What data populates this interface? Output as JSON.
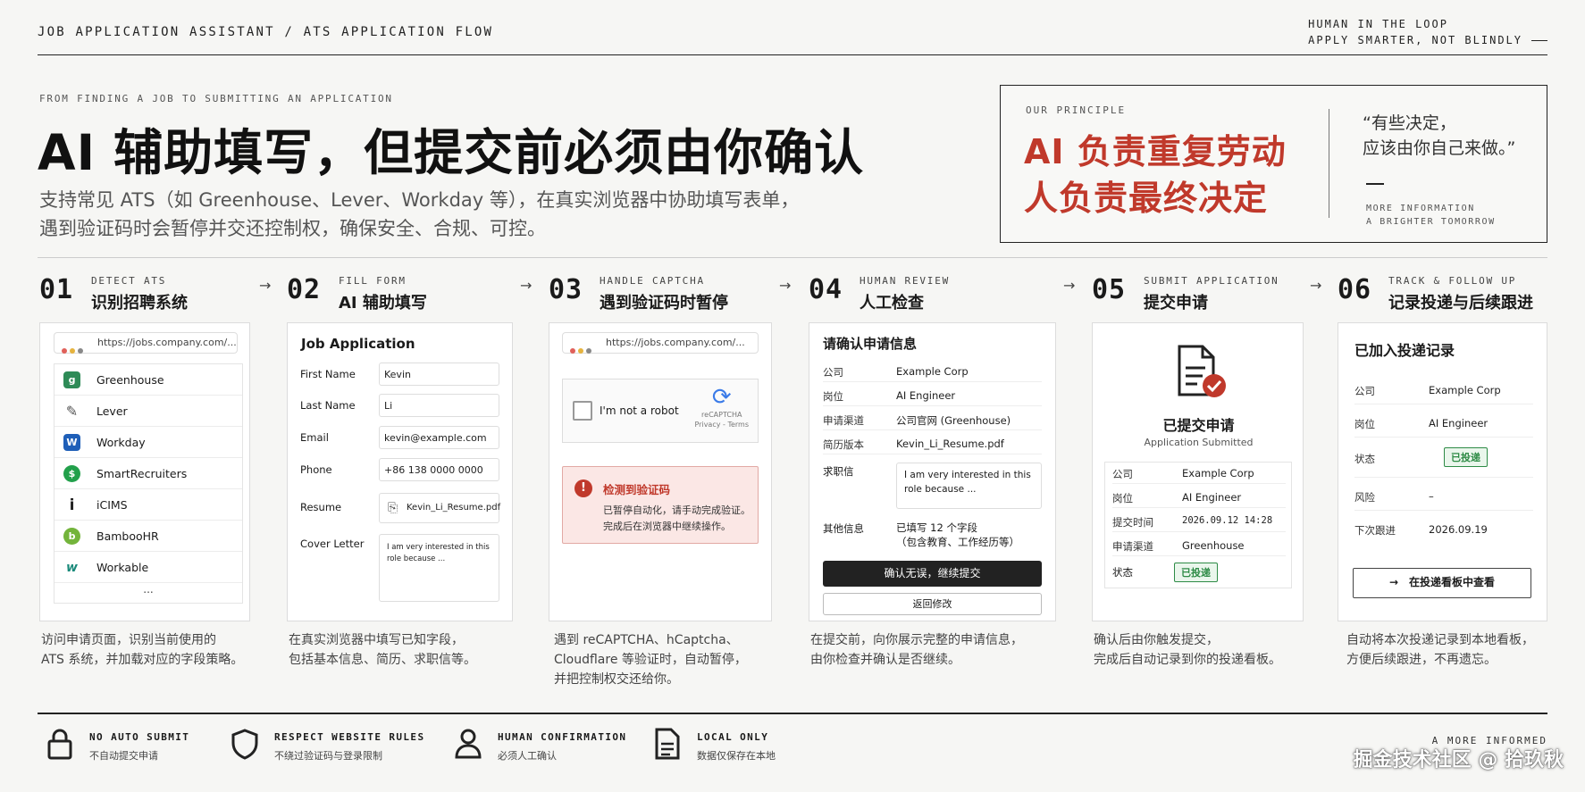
{
  "header": {
    "left": "JOB APPLICATION ASSISTANT / ATS APPLICATION FLOW",
    "right_line1": "HUMAN IN THE LOOP",
    "right_line2": "APPLY SMARTER, NOT BLINDLY"
  },
  "hero": {
    "eyebrow": "FROM FINDING A JOB TO SUBMITTING AN APPLICATION",
    "title": "AI 辅助填写，但提交前必须由你确认",
    "subtitle_line1": "支持常见 ATS（如 Greenhouse、Lever、Workday 等），在真实浏览器中协助填写表单，",
    "subtitle_line2": "遇到验证码时会暂停并交还控制权，确保安全、合规、可控。"
  },
  "principle": {
    "label": "OUR PRINCIPLE",
    "line1": "AI 负责重复劳动",
    "line2": "人负责最终决定",
    "quote_line1": "“有些决定，",
    "quote_line2": "应该由你自己来做。”",
    "more_line1": "MORE INFORMATION",
    "more_line2": "A BRIGHTER TOMORROW"
  },
  "steps": [
    {
      "num": "01",
      "en": "DETECT ATS",
      "zh": "识别招聘系统",
      "desc1": "访问申请页面，识别当前使用的",
      "desc2": "ATS 系统，并加载对应的字段策略。"
    },
    {
      "num": "02",
      "en": "FILL FORM",
      "zh": "AI 辅助填写",
      "desc1": "在真实浏览器中填写已知字段，",
      "desc2": "包括基本信息、简历、求职信等。"
    },
    {
      "num": "03",
      "en": "HANDLE CAPTCHA",
      "zh": "遇到验证码时暂停",
      "desc1": "遇到 reCAPTCHA、hCaptcha、",
      "desc2": "Cloudflare 等验证时，自动暂停，",
      "desc3": "并把控制权交还给你。"
    },
    {
      "num": "04",
      "en": "HUMAN REVIEW",
      "zh": "人工检查",
      "desc1": "在提交前，向你展示完整的申请信息，",
      "desc2": "由你检查并确认是否继续。"
    },
    {
      "num": "05",
      "en": "SUBMIT APPLICATION",
      "zh": "提交申请",
      "desc1": "确认后由你触发提交，",
      "desc2": "完成后自动记录到你的投递看板。"
    },
    {
      "num": "06",
      "en": "TRACK & FOLLOW UP",
      "zh": "记录投递与后续跟进",
      "desc1": "自动将本次投递记录到本地看板，",
      "desc2": "方便后续跟进，不再遗忘。"
    }
  ],
  "card1": {
    "url": "https://jobs.company.com/...",
    "ats": [
      {
        "name": "Greenhouse",
        "icon": "greenhouse-icon",
        "color": "#2e8b57",
        "glyph": "g"
      },
      {
        "name": "Lever",
        "icon": "lever-icon",
        "color": "#555555",
        "glyph": "/"
      },
      {
        "name": "Workday",
        "icon": "workday-icon",
        "color": "#1f5fb8",
        "glyph": "W"
      },
      {
        "name": "SmartRecruiters",
        "icon": "smartrecruiters-icon",
        "color": "#22a04b",
        "glyph": "S"
      },
      {
        "name": "iCIMS",
        "icon": "icims-icon",
        "color": "#222222",
        "glyph": "i"
      },
      {
        "name": "BambooHR",
        "icon": "bamboohr-icon",
        "color": "#73b43b",
        "glyph": "b"
      },
      {
        "name": "Workable",
        "icon": "workable-icon",
        "color": "#1a8a7a",
        "glyph": "w"
      }
    ],
    "more": "..."
  },
  "card2": {
    "title": "Job Application",
    "fields": [
      {
        "label": "First Name",
        "value": "Kevin"
      },
      {
        "label": "Last Name",
        "value": "Li"
      },
      {
        "label": "Email",
        "value": "kevin@example.com"
      },
      {
        "label": "Phone",
        "value": "+86 138 0000 0000"
      },
      {
        "label": "Resume",
        "value": "Kevin_Li_Resume.pdf"
      },
      {
        "label": "Cover Letter",
        "value": "I am very interested in this role because ..."
      }
    ]
  },
  "card3": {
    "url": "https://jobs.company.com/...",
    "captcha_text": "I'm not a robot",
    "captcha_brand": "reCAPTCHA",
    "captcha_links": "Privacy - Terms",
    "alert_title": "检测到验证码",
    "alert_line1": "已暂停自动化，请手动完成验证。",
    "alert_line2": "完成后在浏览器中继续操作。"
  },
  "card4": {
    "title": "请确认申请信息",
    "rows": [
      {
        "k": "公司",
        "v": "Example Corp"
      },
      {
        "k": "岗位",
        "v": "AI Engineer"
      },
      {
        "k": "申请渠道",
        "v": "公司官网 (Greenhouse)"
      },
      {
        "k": "简历版本",
        "v": "Kevin_Li_Resume.pdf"
      }
    ],
    "cover_label": "求职信",
    "cover_text": "I am very interested in this role because ...",
    "other_label": "其他信息",
    "other_line1": "已填写 12 个字段",
    "other_line2": "（包含教育、工作经历等）",
    "confirm_button": "确认无误，继续提交",
    "back_button": "返回修改"
  },
  "card5": {
    "title": "已提交申请",
    "subtitle": "Application Submitted",
    "rows": [
      {
        "k": "公司",
        "v": "Example Corp"
      },
      {
        "k": "岗位",
        "v": "AI Engineer"
      },
      {
        "k": "提交时间",
        "v": "2026.09.12 14:28"
      },
      {
        "k": "申请渠道",
        "v": "Greenhouse"
      }
    ],
    "status_label": "状态",
    "status_value": "已投递"
  },
  "card6": {
    "title": "已加入投递记录",
    "rows": [
      {
        "k": "公司",
        "v": "Example Corp"
      },
      {
        "k": "岗位",
        "v": "AI Engineer"
      }
    ],
    "status_label": "状态",
    "status_value": "已投递",
    "risk_label": "风险",
    "risk_value": "–",
    "next_label": "下次跟进",
    "next_value": "2026.09.19",
    "button_arrow": "→",
    "button": "在投递看板中查看"
  },
  "footer": {
    "features": [
      {
        "icon": "lock-icon",
        "title": "NO AUTO SUBMIT",
        "sub": "不自动提交申请"
      },
      {
        "icon": "shield-icon",
        "title": "RESPECT WEBSITE RULES",
        "sub": "不绕过验证码与登录限制"
      },
      {
        "icon": "person-icon",
        "title": "HUMAN CONFIRMATION",
        "sub": "必须人工确认"
      },
      {
        "icon": "document-icon",
        "title": "LOCAL ONLY",
        "sub": "数据仅保存在本地"
      }
    ],
    "right": "A MORE INFORMED",
    "watermark": "掘金技术社区 @ 拾玖秋"
  },
  "colors": {
    "accent": "#c0392b",
    "success": "#2e8b46",
    "dark": "#222222"
  }
}
